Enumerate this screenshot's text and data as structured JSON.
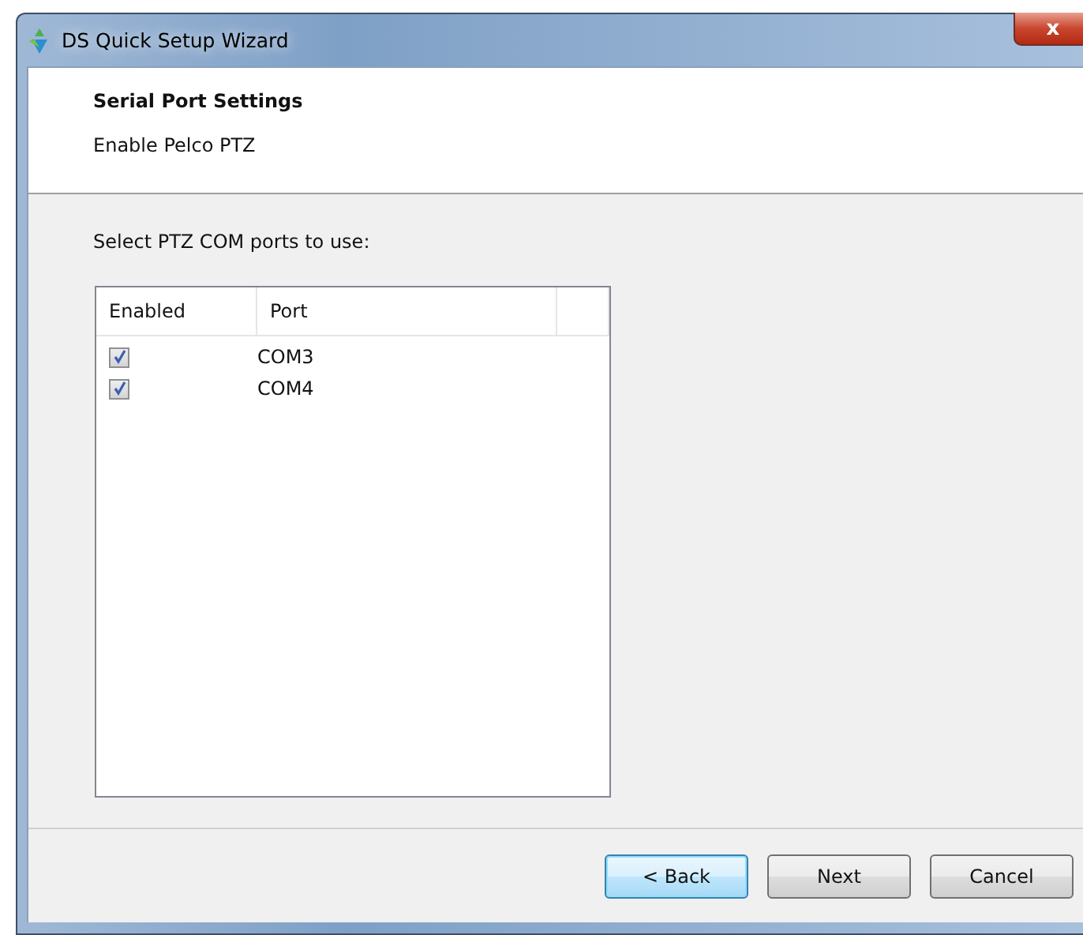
{
  "window": {
    "title": "DS Quick Setup Wizard",
    "close": "x"
  },
  "header": {
    "title": "Serial Port Settings",
    "subtitle": "Enable Pelco PTZ"
  },
  "prompt": "Select PTZ COM ports to use:",
  "table": {
    "columns": [
      "Enabled",
      "Port"
    ],
    "rows": [
      {
        "checked": true,
        "port": "COM3"
      },
      {
        "checked": true,
        "port": "COM4"
      }
    ]
  },
  "buttons": [
    {
      "label": "< Back",
      "focused": true
    },
    {
      "label": "Next",
      "focused": false
    },
    {
      "label": "Cancel",
      "focused": false
    }
  ]
}
